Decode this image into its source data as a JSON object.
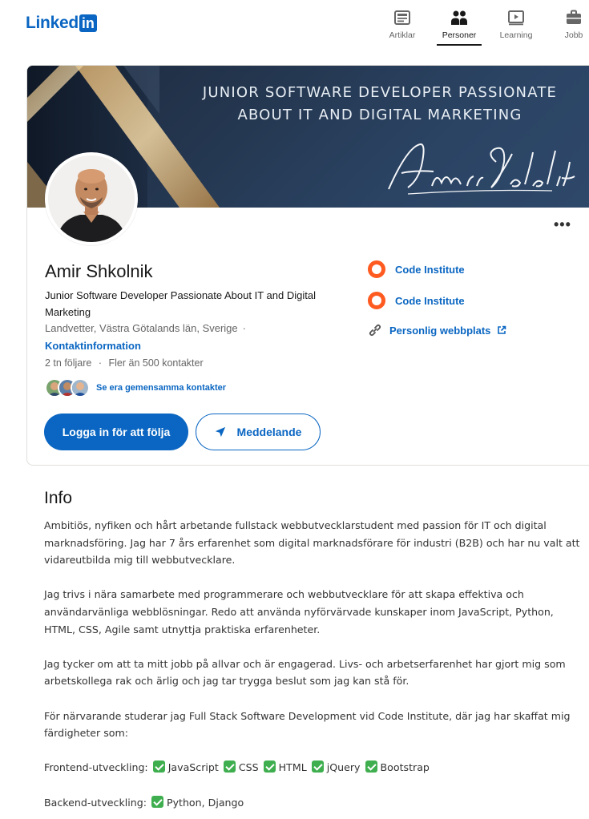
{
  "nav": {
    "logo_word": "Linked",
    "logo_box": "in",
    "items": [
      {
        "label": "Artiklar",
        "icon": "articles-icon"
      },
      {
        "label": "Personer",
        "icon": "people-icon",
        "active": true
      },
      {
        "label": "Learning",
        "icon": "learning-icon"
      },
      {
        "label": "Jobb",
        "icon": "briefcase-icon"
      }
    ]
  },
  "banner": {
    "line1": "JUNIOR SOFTWARE DEVELOPER PASSIONATE",
    "line2": "ABOUT IT AND DIGITAL MARKETING",
    "signature": "Amir Shkolnik"
  },
  "profile": {
    "name": "Amir Shkolnik",
    "headline": "Junior Software Developer Passionate About IT and Digital Marketing",
    "location": "Landvetter, Västra Götalands län, Sverige",
    "location_separator": "·",
    "contact_info": "Kontaktinformation",
    "followers": "2 tn följare",
    "followers_separator": "·",
    "connections": "Fler än 500 kontakter",
    "mutual_connections": "Se era gemensamma kontakter",
    "more_button": "•••",
    "follow_button": "Logga in för att följa",
    "message_button": "Meddelande"
  },
  "side": {
    "school1": "Code Institute",
    "school2": "Code Institute",
    "website": "Personlig webbplats"
  },
  "info": {
    "title": "Info",
    "p1": "Ambitiös, nyfiken och hårt arbetande fullstack webbutvecklarstudent med passion för IT och digital marknadsföring. Jag har 7 års erfarenhet som digital marknadsförare för industri (B2B) och har nu valt att vidareutbilda mig till webbutvecklare.",
    "p2": "Jag trivs i nära samarbete med programmerare och webbutvecklare för att skapa effektiva och användarvänliga webblösningar. Redo att använda nyförvärvade kunskaper inom JavaScript, Python, HTML, CSS, Agile samt utnyttja praktiska erfarenheter.",
    "p3": "Jag tycker om att ta mitt jobb på allvar och är engagerad. Livs- och arbetserfarenhet har gjort mig som arbetskollega rak och ärlig och jag tar trygga beslut som jag kan stå för.",
    "p4": "För närvarande studerar jag Full Stack Software Development vid Code Institute, där jag har skaffat mig färdigheter som:",
    "frontend_label": "Frontend-utveckling:",
    "frontend_skills": [
      "JavaScript",
      "CSS",
      "HTML",
      "jQuery",
      "Bootstrap"
    ],
    "backend_label": "Backend-utveckling:",
    "backend_skills": "Python, Django"
  },
  "colors": {
    "brand": "#0a66c2",
    "school_ring": "#ff5a1f",
    "check_green": "#3fae4f"
  }
}
